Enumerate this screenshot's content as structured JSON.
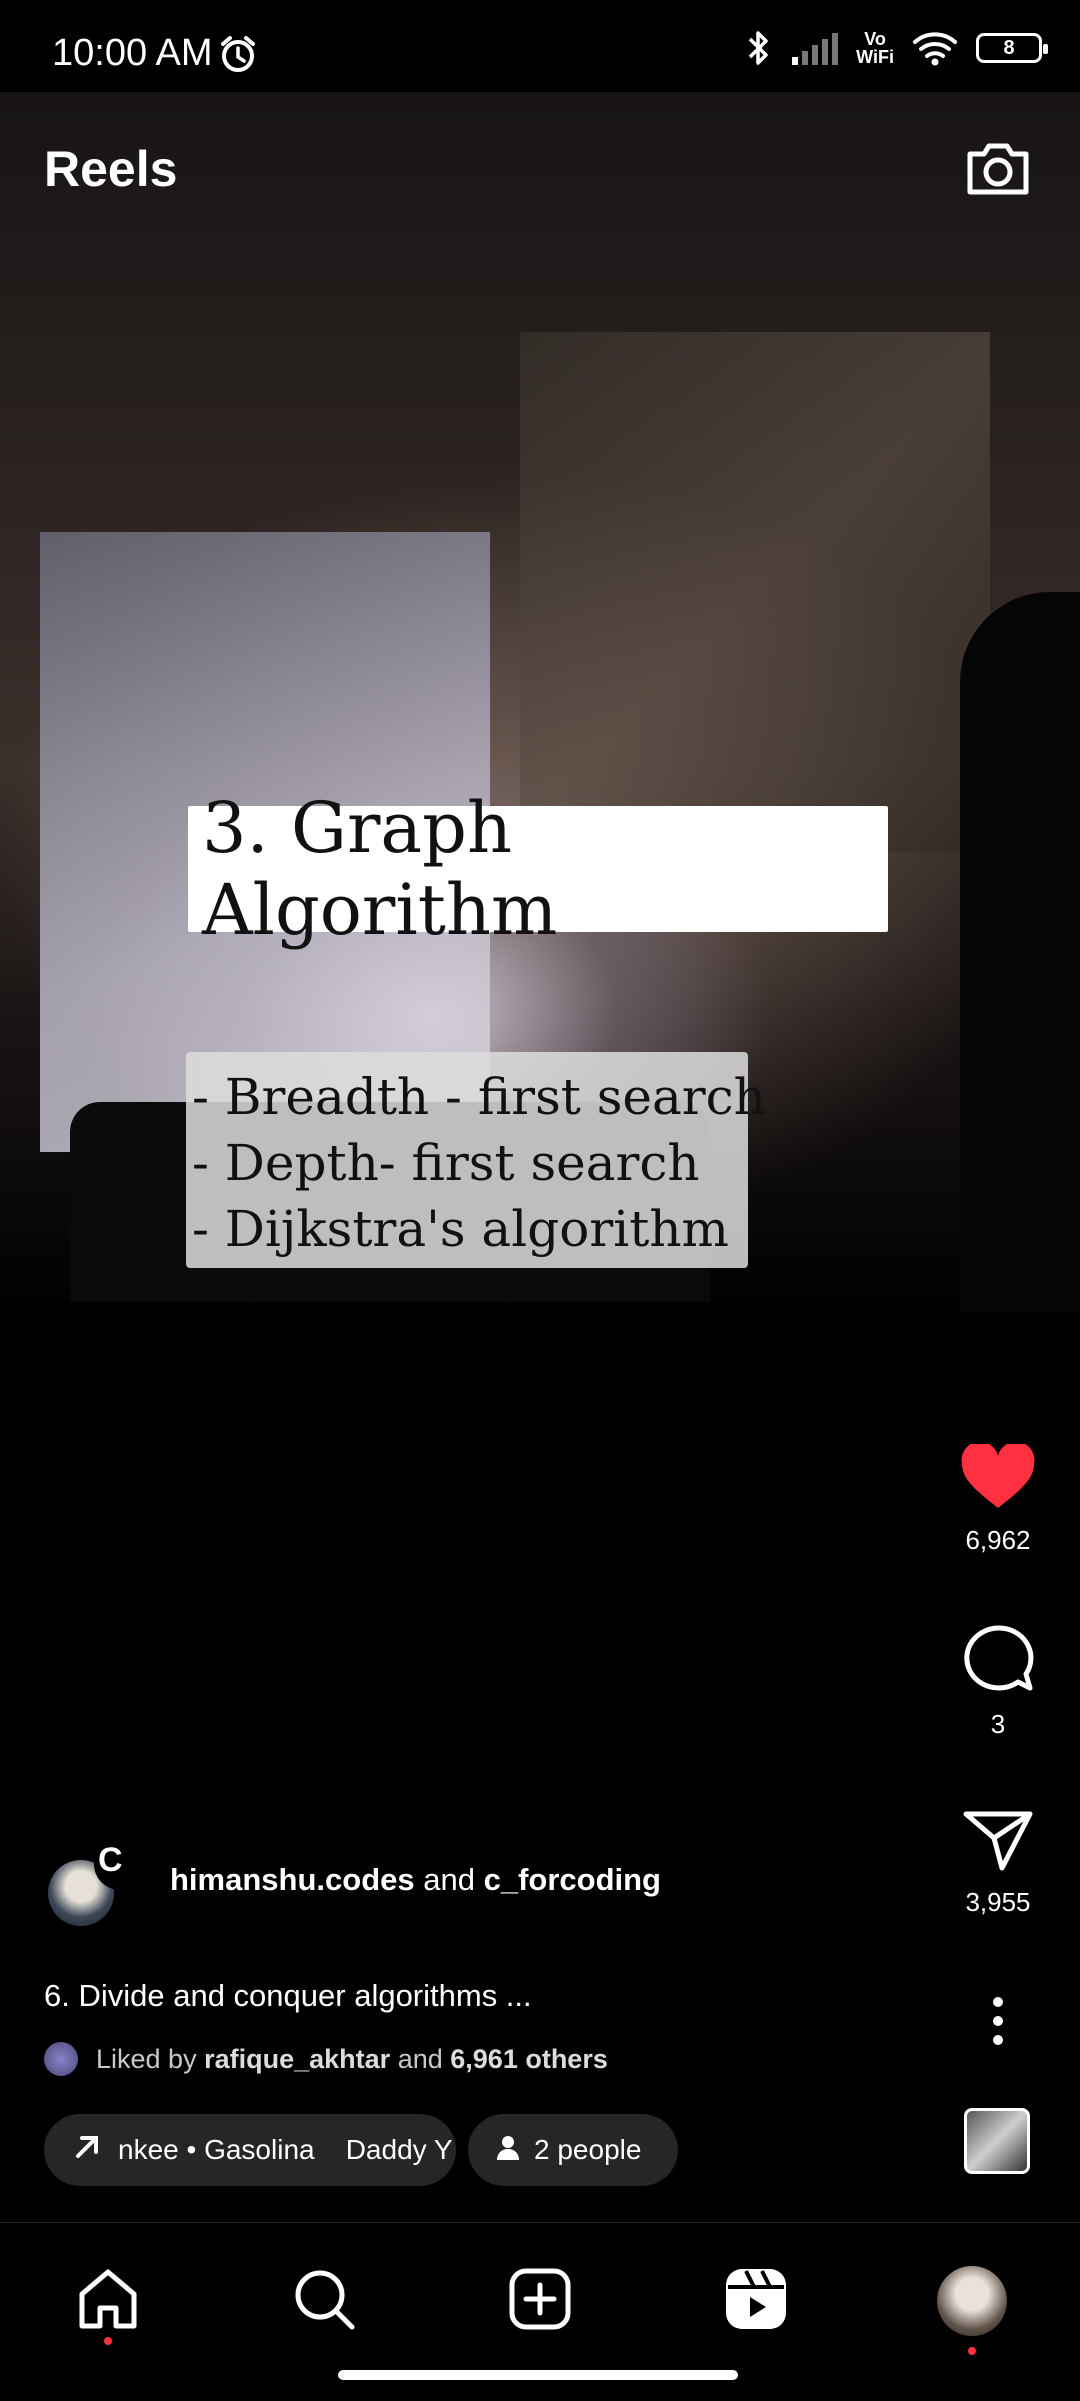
{
  "status_bar": {
    "time": "10:00 AM",
    "vo_line1": "Vo",
    "vo_line2": "WiFi",
    "battery": "8",
    "icons": [
      "alarm-icon",
      "bluetooth-icon",
      "signal-icon",
      "vowifi-icon",
      "wifi-icon",
      "battery-icon"
    ]
  },
  "header": {
    "title": "Reels",
    "camera_icon": "camera-icon"
  },
  "video": {
    "overlay_title": "3. Graph Algorithm",
    "overlay_items": [
      "- Breadth - first search",
      "- Depth- first search",
      "- Dijkstra's algorithm"
    ]
  },
  "actions": {
    "likes": "6,962",
    "comments": "3",
    "shares": "3,955",
    "like_color": "#ff3040"
  },
  "author": {
    "collab_initial": "C",
    "name": "himanshu.codes",
    "joiner": "and",
    "collaborator": "c_forcoding"
  },
  "caption": "6. Divide and conquer algorithms ...",
  "liked_by": {
    "prefix": "Liked by",
    "user": "rafique_akhtar",
    "joiner": "and",
    "others": "6,961 others"
  },
  "music": {
    "text": "nkee • Gasolina    Daddy Y"
  },
  "people": {
    "text": "2 people"
  },
  "nav": [
    "home-icon",
    "search-icon",
    "create-icon",
    "reels-icon",
    "profile-avatar"
  ]
}
